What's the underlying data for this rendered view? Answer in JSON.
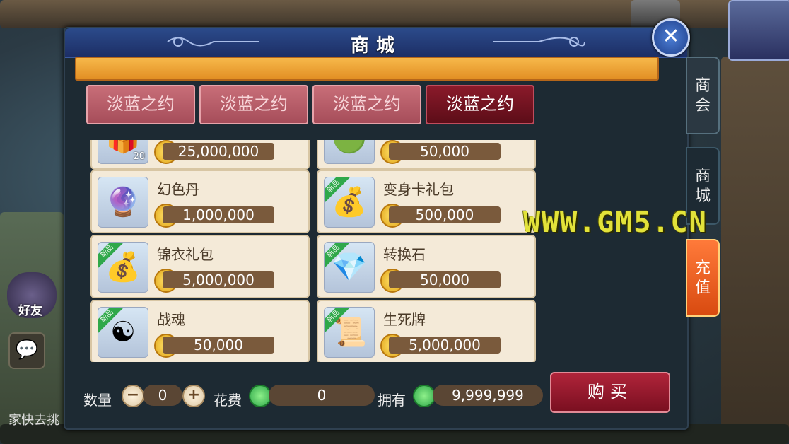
{
  "window": {
    "title": "商城",
    "close_label": "✕"
  },
  "tabs": [
    {
      "label": "淡蓝之约",
      "active": false
    },
    {
      "label": "淡蓝之约",
      "active": false
    },
    {
      "label": "淡蓝之约",
      "active": false
    },
    {
      "label": "淡蓝之约",
      "active": true
    }
  ],
  "items": [
    {
      "name": "",
      "price": "25,000,000",
      "qty": "20",
      "icon": "bundle-icon",
      "new": false
    },
    {
      "name": "",
      "price": "50,000",
      "qty": "",
      "icon": "orb-icon",
      "new": false
    },
    {
      "name": "幻色丹",
      "price": "1,000,000",
      "qty": "",
      "icon": "magenta-pearl-icon",
      "new": false
    },
    {
      "name": "变身卡礼包",
      "price": "500,000",
      "qty": "",
      "icon": "gift-sack-icon",
      "new": true
    },
    {
      "name": "锦衣礼包",
      "price": "5,000,000",
      "qty": "",
      "icon": "gift-sack-icon",
      "new": true
    },
    {
      "name": "转换石",
      "price": "50,000",
      "qty": "",
      "icon": "blue-gem-icon",
      "new": true
    },
    {
      "name": "战魂",
      "price": "50,000",
      "qty": "",
      "icon": "war-soul-icon",
      "new": true
    },
    {
      "name": "生死牌",
      "price": "5,000,000",
      "qty": "",
      "icon": "scroll-icon",
      "new": true
    }
  ],
  "new_tag": "新品",
  "side_tabs": {
    "chamber": "商会",
    "shop": "商城",
    "recharge": "充值"
  },
  "bottom": {
    "quantity_label": "数量",
    "quantity_value": "0",
    "minus": "−",
    "plus": "+",
    "cost_label": "花费",
    "cost_value": "0",
    "own_label": "拥有",
    "own_value": "9,999,999",
    "buy_label": "购买"
  },
  "left_hud": {
    "friends_label": "好友",
    "chat_icon": "chat-icon",
    "message_snippet": "家快去挑"
  },
  "watermark": "WWW.GM5.CN",
  "colors": {
    "title_blue": "#2b4a8a",
    "active_tab": "#8a1a2a",
    "inactive_tab": "#c86e78",
    "card_bg": "#f4ead8",
    "coin_gold": "#ffe46a",
    "jade_green": "#2fa84a"
  }
}
